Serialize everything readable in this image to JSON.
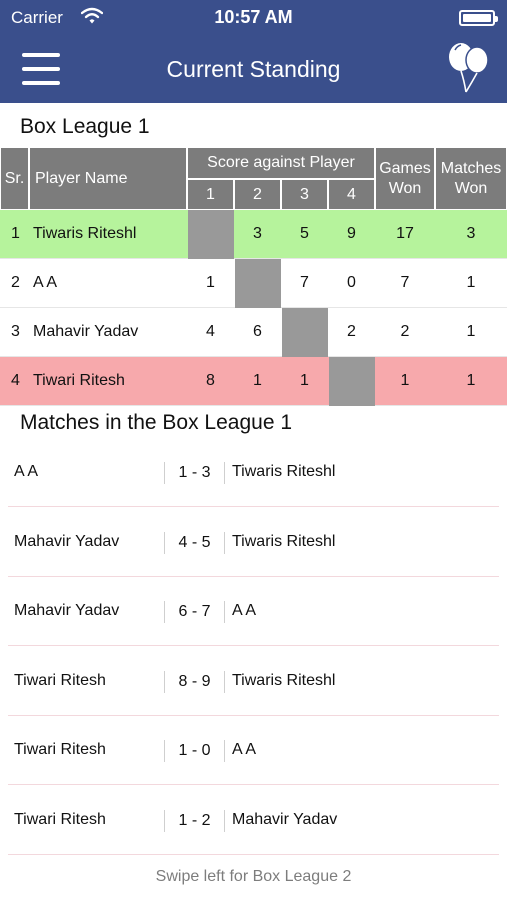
{
  "status_bar": {
    "carrier": "Carrier",
    "time": "10:57 AM"
  },
  "nav": {
    "title": "Current Standing",
    "menu_icon": "hamburger-menu-icon",
    "action_icon": "balloons-icon",
    "bar_color": "#3a4f8c"
  },
  "standings": {
    "title": "Box League 1",
    "headers": {
      "sr": "Sr.",
      "player_name": "Player Name",
      "score_against": "Score against Player",
      "cols": [
        "1",
        "2",
        "3",
        "4"
      ],
      "games_won": "Games Won",
      "matches_won": "Matches Won"
    },
    "rows": [
      {
        "sr": "1",
        "name": "Tiwaris Riteshl",
        "scores": [
          "",
          "3",
          "5",
          "9"
        ],
        "games_won": "17",
        "matches_won": "3"
      },
      {
        "sr": "2",
        "name": "A A",
        "scores": [
          "1",
          "",
          "7",
          "0"
        ],
        "games_won": "7",
        "matches_won": "1"
      },
      {
        "sr": "3",
        "name": "Mahavir Yadav",
        "scores": [
          "4",
          "6",
          "",
          "2"
        ],
        "games_won": "2",
        "matches_won": "1"
      },
      {
        "sr": "4",
        "name": "Tiwari Ritesh",
        "scores": [
          "8",
          "1",
          "1",
          ""
        ],
        "games_won": "1",
        "matches_won": "1"
      }
    ],
    "colors": {
      "leader": "#b6f39c",
      "last": "#f7a9ac",
      "header": "#7c7c7c",
      "self_cell": "#999999"
    }
  },
  "matches": {
    "title": "Matches in the Box League 1",
    "items": [
      {
        "left": "A A",
        "score": "1 - 3",
        "right": "Tiwaris Riteshl"
      },
      {
        "left": "Mahavir Yadav",
        "score": "4 - 5",
        "right": "Tiwaris Riteshl"
      },
      {
        "left": "Mahavir Yadav",
        "score": "6 - 7",
        "right": "A A"
      },
      {
        "left": "Tiwari Ritesh",
        "score": "8 - 9",
        "right": "Tiwaris Riteshl"
      },
      {
        "left": "Tiwari Ritesh",
        "score": "1 - 0",
        "right": "A A"
      },
      {
        "left": "Tiwari Ritesh",
        "score": "1 - 2",
        "right": "Mahavir Yadav"
      }
    ]
  },
  "footer": {
    "hint": "Swipe left for Box League 2"
  }
}
